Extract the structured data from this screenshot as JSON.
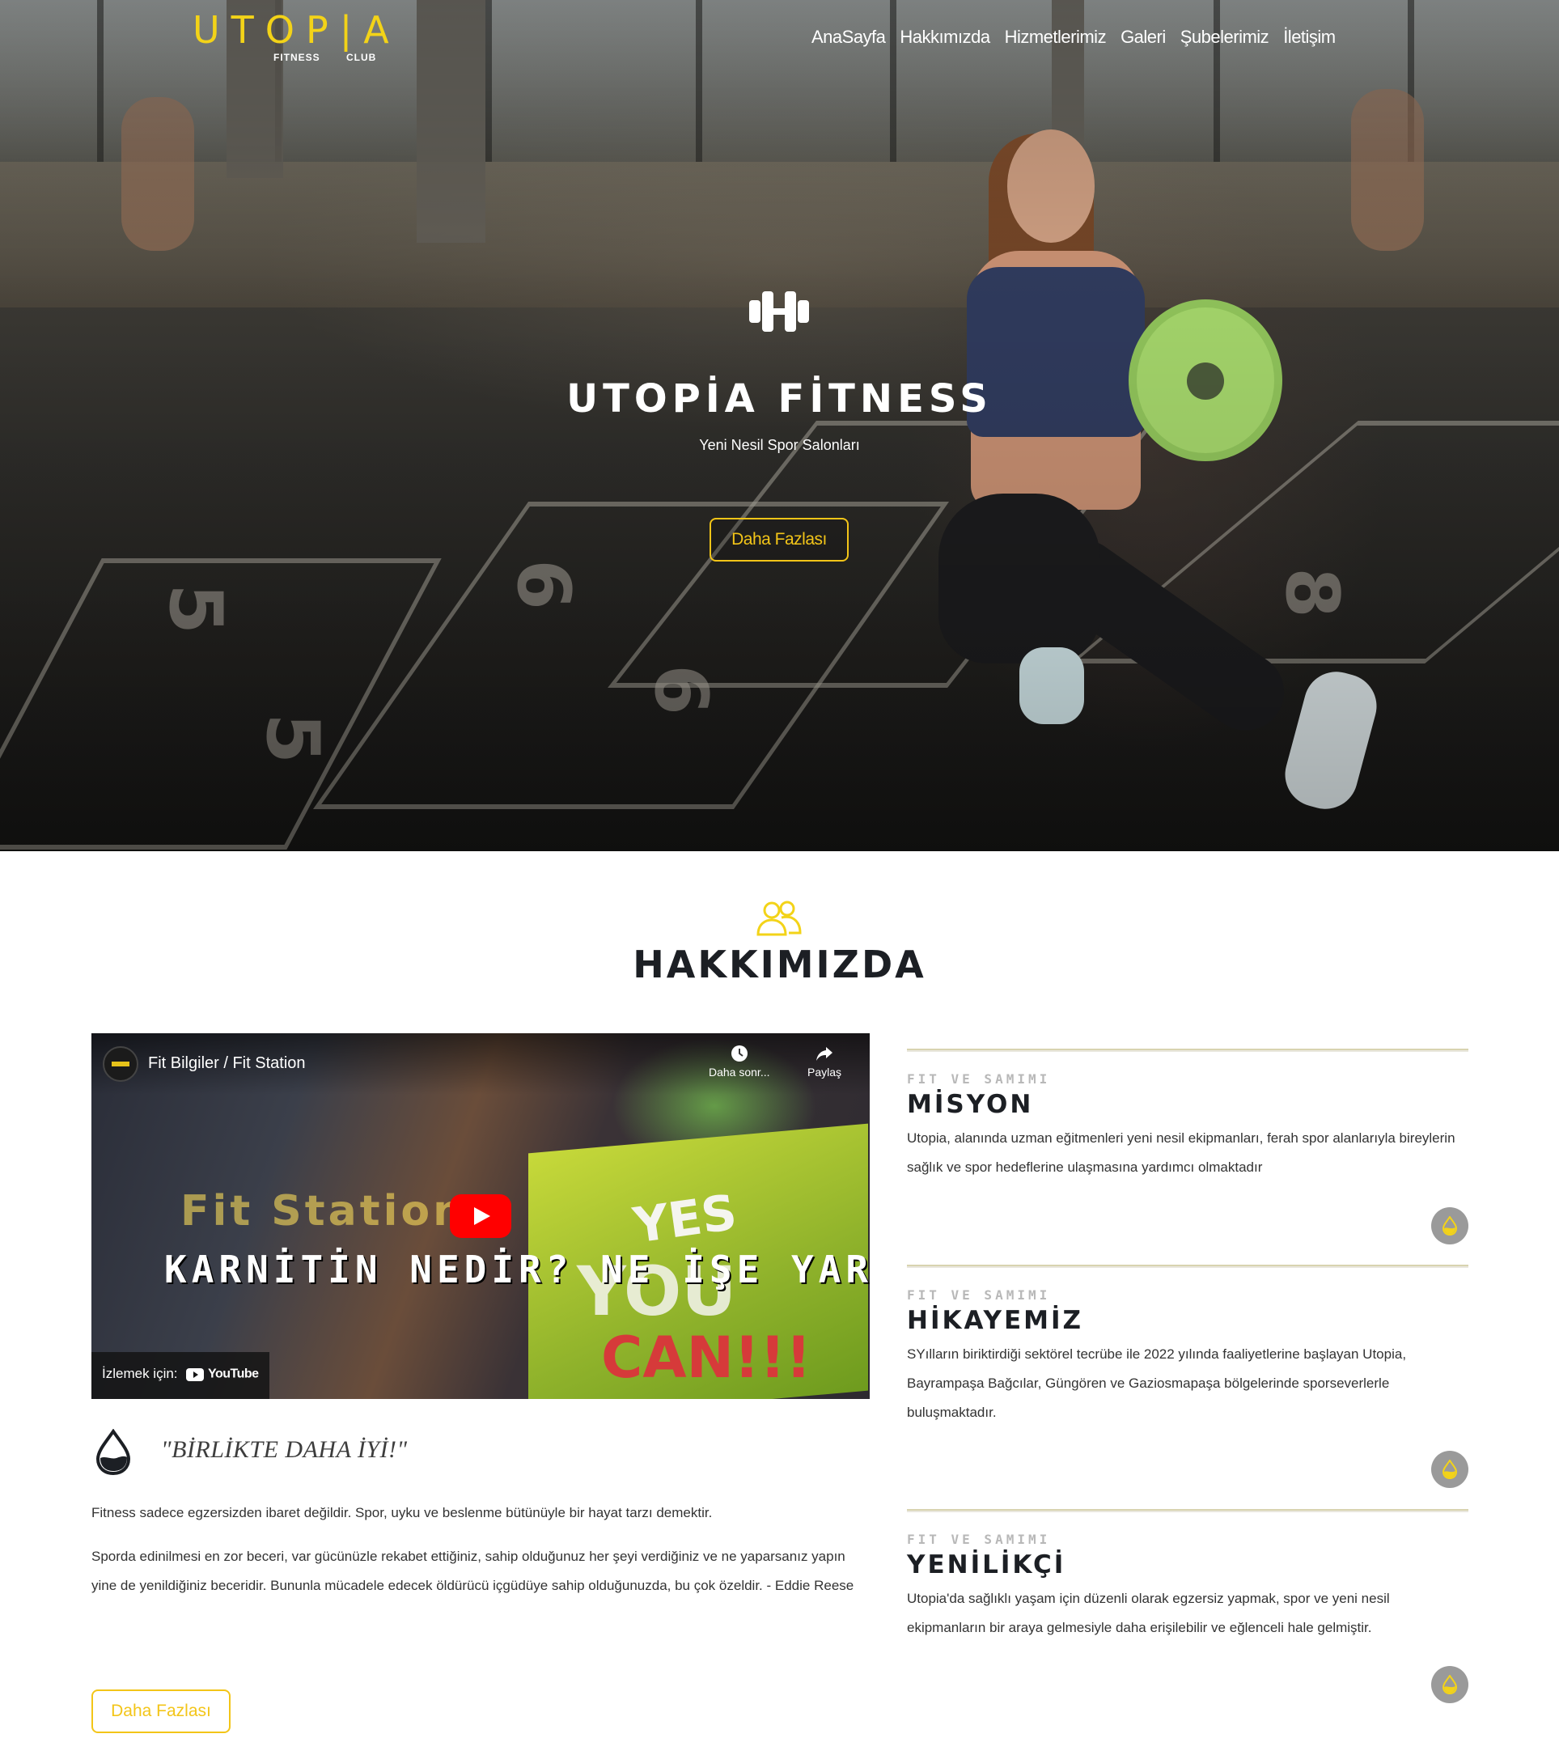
{
  "brand": {
    "logo_main": "UTOP|A",
    "logo_sub_left": "FITNESS",
    "logo_sub_right": "CLUB",
    "accent_color": "#f3d318",
    "dark_color": "#1c1f24"
  },
  "nav": {
    "items": [
      "AnaSayfa",
      "Hakkımızda",
      "Hizmetlerimiz",
      "Galeri",
      "Şubelerimiz",
      "İletişim"
    ]
  },
  "hero": {
    "icon": "dumbbell-icon",
    "title": "UTOPİA FİTNESS",
    "subtitle": "Yeni Nesil Spor Salonları",
    "button_label": "Daha Fazlası"
  },
  "about": {
    "icon": "users-icon",
    "title": "HAKKIMIZDA",
    "video": {
      "channel_title": "Fit Bilgiler / Fit Station",
      "overlay_text": "KARNİTİN NEDİR? NE İŞE YARAR?",
      "sign_text": "Fit Station",
      "box_text_1": "YES",
      "box_text_2": "YOU",
      "box_text_3": "CAN!!!",
      "watch_later_label": "Daha sonr...",
      "share_label": "Paylaş",
      "watch_on_label": "İzlemek için:",
      "youtube_word": "YouTube"
    },
    "quote": "\"BİRLİKTE DAHA İYİ!\"",
    "paragraph_1": "Fitness sadece egzersizden ibaret değildir. Spor, uyku ve beslenme bütünüyle bir hayat tarzı demektir.",
    "paragraph_2": "Sporda edinilmesi en zor beceri, var gücünüzle rekabet ettiğiniz, sahip olduğunuz her şeyi verdiğiniz ve ne yaparsanız yapın yine de yenildiğiniz beceridir. Bununla mücadele edecek öldürücü içgüdüye sahip olduğunuzda, bu çok özeldir. - Eddie Reese",
    "button_label": "Daha Fazlası",
    "cards": [
      {
        "eyebrow": "FIT VE SAMIMI",
        "title": "MİSYON",
        "text": "Utopia, alanında uzman eğitmenleri yeni nesil ekipmanları, ferah spor alanlarıyla bireylerin sağlık ve spor hedeflerine ulaşmasına yardımcı olmaktadır"
      },
      {
        "eyebrow": "FIT VE SAMIMI",
        "title": "HİKAYEMİZ",
        "text": "SYılların biriktirdiği sektörel tecrübe ile 2022 yılında faaliyetlerine başlayan Utopia, Bayrampaşa Bağcılar, Güngören ve Gaziosmapaşa bölgelerinde sporseverlerle buluşmaktadır."
      },
      {
        "eyebrow": "FIT VE SAMIMI",
        "title": "YENİLİKÇİ",
        "text": "Utopia'da sağlıklı yaşam için düzenli olarak egzersiz yapmak, spor ve yeni nesil ekipmanların bir araya gelmesiyle daha erişilebilir ve eğlenceli hale gelmiştir."
      }
    ]
  }
}
